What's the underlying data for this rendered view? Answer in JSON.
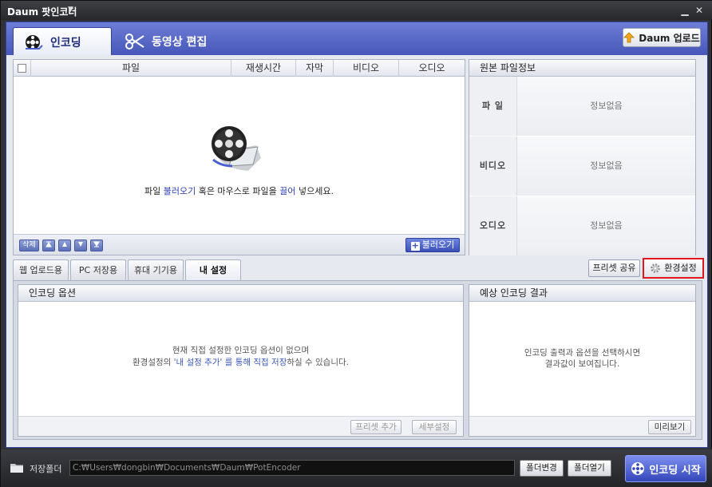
{
  "window": {
    "title": "Daum 팟인코더"
  },
  "main_tabs": [
    {
      "label": "인코딩",
      "active": true
    },
    {
      "label": "동영상 편집",
      "active": false
    }
  ],
  "upload_button": "Daum 업로드",
  "file_list": {
    "columns": [
      "파일",
      "재생시간",
      "자막",
      "비디오",
      "오디오"
    ],
    "drop_text": {
      "part1": "파일 ",
      "link_load": "불러오기",
      "part2": " 혹은 마우스로 파일을 ",
      "link_drag": "끌어",
      "part3": " 넣으세요."
    },
    "delete_label": "삭제",
    "load_label": "불러오기"
  },
  "source_info": {
    "title": "원본 파일정보",
    "rows": [
      {
        "label": "파 일",
        "value": "정보없음"
      },
      {
        "label": "비디오",
        "value": "정보없음"
      },
      {
        "label": "오디오",
        "value": "정보없음"
      }
    ]
  },
  "preset_tabs": [
    {
      "label": "웹 업로드용"
    },
    {
      "label": "PC 저장용"
    },
    {
      "label": "휴대 기기용"
    },
    {
      "label": "내 설정",
      "active": true
    }
  ],
  "preset_share_label": "프리셋 공유",
  "settings_label": "환경설정",
  "encoding_options": {
    "title": "인코딩 옵션",
    "message_line1": "현재 직접 설정한 인코딩 옵션이 없으며",
    "message_line2_pre": "환경설정의 ",
    "message_line2_hl": "'내 설정 추가' 를 통해 직접 저장",
    "message_line2_post": "하실 수 있습니다.",
    "add_preset_label": "프리셋 추가",
    "detail_label": "세부설정"
  },
  "expected_result": {
    "title": "예상 인코딩 결과",
    "message_line1": "인코딩 출력과 옵션을 선택하시면",
    "message_line2": "결과값이 보여집니다.",
    "preview_label": "미리보기"
  },
  "bottom_bar": {
    "folder_label": "저장폴더",
    "path": "C:₩Users₩dongbin₩Documents₩Daum₩PotEncoder",
    "change_folder_label": "폴더변경",
    "open_folder_label": "폴더열기",
    "start_label": "인코딩 시작"
  },
  "colors": {
    "accent": "#4657b8",
    "highlight": "#e0181e"
  }
}
